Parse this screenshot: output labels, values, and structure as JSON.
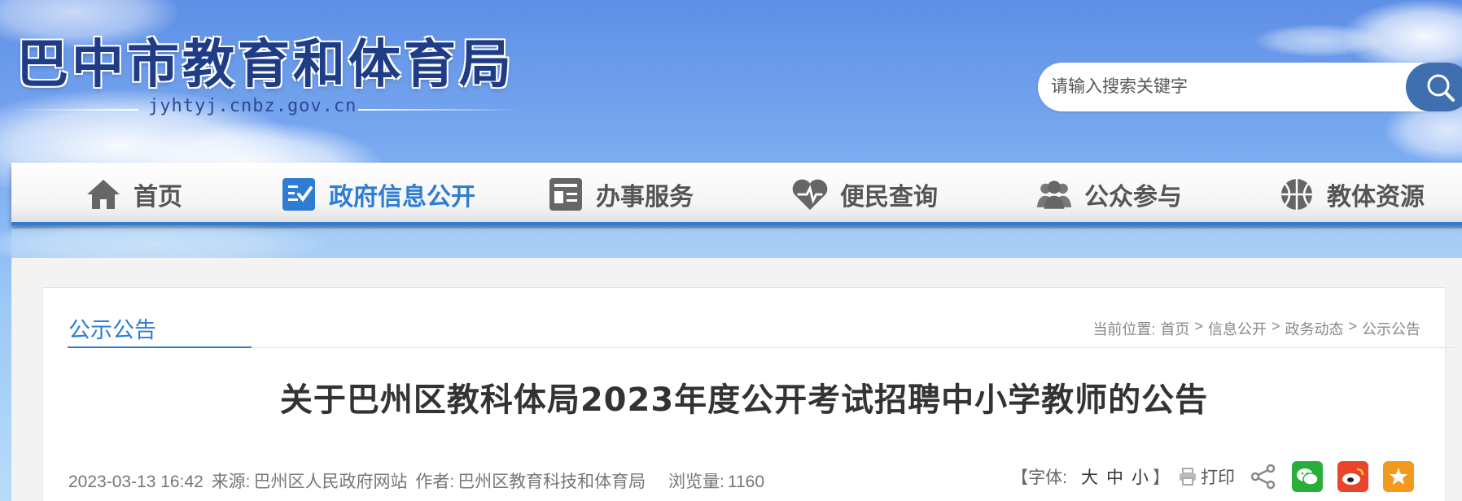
{
  "header": {
    "site_title": "巴中市教育和体育局",
    "site_url": "jyhtyj.cnbz.gov.cn",
    "search_placeholder": "请输入搜索关键字"
  },
  "nav": {
    "items": [
      {
        "label": "首页",
        "icon": "home-icon"
      },
      {
        "label": "政府信息公开",
        "icon": "info-disclosure-icon",
        "active": true
      },
      {
        "label": "办事服务",
        "icon": "service-icon"
      },
      {
        "label": "便民查询",
        "icon": "heart-query-icon"
      },
      {
        "label": "公众参与",
        "icon": "people-icon"
      },
      {
        "label": "教体资源",
        "icon": "basketball-icon"
      }
    ]
  },
  "section": {
    "title": "公示公告",
    "breadcrumb": {
      "prefix": "当前位置:",
      "items": [
        "首页",
        "信息公开",
        "政务动态",
        "公示公告"
      ],
      "separator": ">"
    }
  },
  "article": {
    "title": "关于巴州区教科体局2023年度公开考试招聘中小学教师的公告",
    "datetime": "2023-03-13 16:42",
    "source_label": "来源:",
    "source": "巴州区人民政府网站",
    "author_label": "作者:",
    "author": "巴州区教育科技和体育局",
    "views_label": "浏览量:",
    "views": "1160"
  },
  "tools": {
    "font_label": "【字体:",
    "font_large": "大",
    "font_medium": "中",
    "font_small": "小",
    "font_close": "】",
    "print_label": "打印",
    "share_colors": {
      "wechat": "#2aae3a",
      "weibo": "#e8452b",
      "favorite": "#f39a1e"
    }
  },
  "colors": {
    "accent": "#2f7dd2",
    "brand_dark": "#1f3c86"
  }
}
